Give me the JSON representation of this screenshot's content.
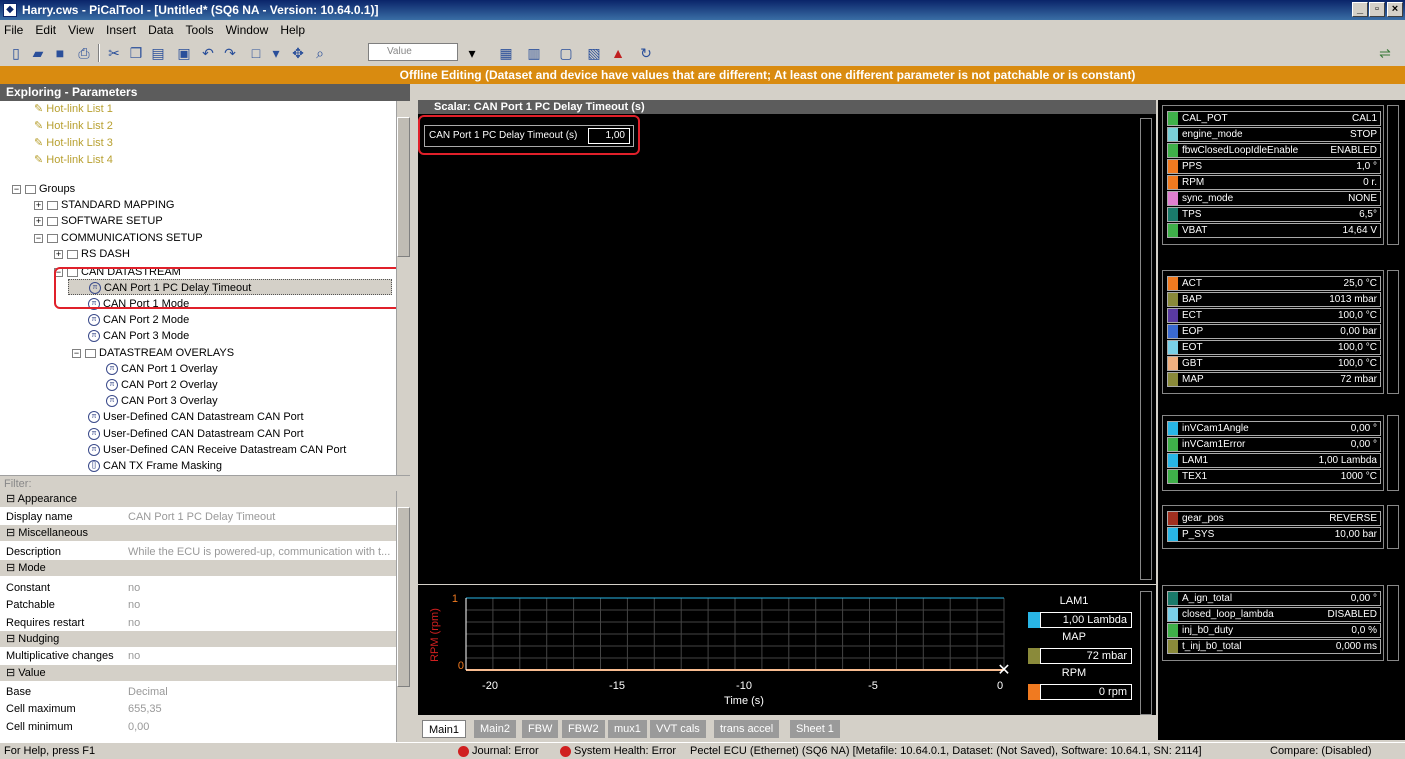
{
  "titlebar": {
    "title": "Harry.cws - PiCalTool - [Untitled* (SQ6 NA - Version: 10.64.0.1)]"
  },
  "menu": [
    "File",
    "Edit",
    "View",
    "Insert",
    "Data",
    "Tools",
    "Window",
    "Help"
  ],
  "toolbar": {
    "value_placeholder": "Value"
  },
  "banner": "Offline Editing (Dataset and device have values that are different; At least one different parameter is not patchable or is constant)",
  "explorer": {
    "title": "Exploring - Parameters",
    "hotlinks": [
      "Hot-link List 1",
      "Hot-link List 2",
      "Hot-link List 3",
      "Hot-link List 4"
    ],
    "groups": "Groups",
    "standard_mapping": "STANDARD MAPPING",
    "software_setup": "SOFTWARE SETUP",
    "communications_setup": "COMMUNICATIONS SETUP",
    "rs_dash": "RS DASH",
    "can_datastream": "CAN DATASTREAM",
    "can_items": [
      "CAN Port 1 PC Delay Timeout",
      "CAN Port 1 Mode",
      "CAN Port 2 Mode",
      "CAN Port 3 Mode"
    ],
    "overlays": "DATASTREAM OVERLAYS",
    "overlay_items": [
      "CAN Port 1 Overlay",
      "CAN Port 2 Overlay",
      "CAN Port 3 Overlay"
    ],
    "user_items": [
      "User-Defined CAN Datastream CAN Port",
      "User-Defined CAN Datastream CAN Port",
      "User-Defined CAN Receive Datastream CAN Port",
      "CAN TX Frame Masking"
    ],
    "filter": "Filter:"
  },
  "properties": {
    "appearance": "Appearance",
    "display_name_k": "Display name",
    "display_name_v": "CAN Port 1 PC Delay Timeout",
    "misc": "Miscellaneous",
    "description_k": "Description",
    "description_v": "While the ECU is powered-up, communication with t...",
    "mode": "Mode",
    "constant_k": "Constant",
    "constant_v": "no",
    "patchable_k": "Patchable",
    "patchable_v": "no",
    "restart_k": "Requires restart",
    "restart_v": "no",
    "nudging": "Nudging",
    "mult_k": "Multiplicative changes",
    "mult_v": "no",
    "value": "Value",
    "base_k": "Base",
    "base_v": "Decimal",
    "cellmax_k": "Cell maximum",
    "cellmax_v": "655,35",
    "cellmin_k": "Cell minimum",
    "cellmin_v": "0,00"
  },
  "scalar": {
    "title": "Scalar: CAN Port 1 PC Delay Timeout (s)",
    "item_label": "CAN Port 1 PC Delay Timeout (s)",
    "item_value": "1,00"
  },
  "graph": {
    "ylabel": "RPM (rpm)",
    "xlabel": "Time (s)",
    "ytick_top": "1",
    "ytick_bottom": "0",
    "xticks": [
      "-20",
      "-15",
      "-10",
      "-5",
      "0"
    ],
    "items": [
      {
        "name": "LAM1",
        "value": "1,00 Lambda",
        "color": "#29b6e6"
      },
      {
        "name": "MAP",
        "value": "72 mbar",
        "color": "#8a8a3a"
      },
      {
        "name": "RPM",
        "value": "0 rpm",
        "color": "#f07a20"
      }
    ]
  },
  "tabs": [
    "Main1",
    "Main2",
    "FBW",
    "FBW2",
    "mux1",
    "VVT cals",
    "trans accel",
    "Sheet 1"
  ],
  "gauges": [
    [
      {
        "name": "CAL_POT",
        "value": "CAL1",
        "color": "#3fb04a"
      },
      {
        "name": "engine_mode",
        "value": "STOP",
        "color": "#7ad0d8"
      },
      {
        "name": "fbwClosedLoopIdleEnable",
        "value": "ENABLED",
        "color": "#3fb04a"
      },
      {
        "name": "PPS",
        "value": "1,0 °",
        "color": "#f07a20"
      },
      {
        "name": "RPM",
        "value": "0 r.",
        "color": "#f07a20"
      },
      {
        "name": "sync_mode",
        "value": "NONE",
        "color": "#e080d0"
      },
      {
        "name": "TPS",
        "value": "6,5°",
        "color": "#1a7a6a"
      },
      {
        "name": "VBAT",
        "value": "14,64 V",
        "color": "#3fb04a"
      }
    ],
    [
      {
        "name": "ACT",
        "value": "25,0 °C",
        "color": "#f07a20"
      },
      {
        "name": "BAP",
        "value": "1013 mbar",
        "color": "#8a8a3a"
      },
      {
        "name": "ECT",
        "value": "100,0 °C",
        "color": "#5a3aa0"
      },
      {
        "name": "EOP",
        "value": "0,00 bar",
        "color": "#3a6ad0"
      },
      {
        "name": "EOT",
        "value": "100,0 °C",
        "color": "#7ad0e8"
      },
      {
        "name": "GBT",
        "value": "100,0 °C",
        "color": "#f0b080"
      },
      {
        "name": "MAP",
        "value": "72 mbar",
        "color": "#8a8a3a"
      }
    ],
    [
      {
        "name": "inVCam1Angle",
        "value": "0,00 °",
        "color": "#29b6e6"
      },
      {
        "name": "inVCam1Error",
        "value": "0,00 °",
        "color": "#3fb04a"
      },
      {
        "name": "LAM1",
        "value": "1,00 Lambda",
        "color": "#29b6e6"
      },
      {
        "name": "TEX1",
        "value": "1000 °C",
        "color": "#3fb04a"
      }
    ],
    [
      {
        "name": "gear_pos",
        "value": "REVERSE",
        "color": "#a03020"
      },
      {
        "name": "P_SYS",
        "value": "10,00 bar",
        "color": "#29b6e6"
      }
    ],
    [
      {
        "name": "A_ign_total",
        "value": "0,00 °",
        "color": "#1a7a6a"
      },
      {
        "name": "closed_loop_lambda",
        "value": "DISABLED",
        "color": "#7ad0e8"
      },
      {
        "name": "inj_b0_duty",
        "value": "0,0 %",
        "color": "#3fb04a"
      },
      {
        "name": "t_inj_b0_total",
        "value": "0,000 ms",
        "color": "#8a8a3a"
      }
    ]
  ],
  "status": {
    "help": "For Help, press F1",
    "journal": "Journal: Error",
    "health": "System Health: Error",
    "ecu": "Pectel ECU (Ethernet) (SQ6 NA) [Metafile: 10.64.0.1, Dataset: (Not Saved), Software: 10.64.1, SN: 2114]",
    "compare": "Compare: (Disabled)"
  }
}
